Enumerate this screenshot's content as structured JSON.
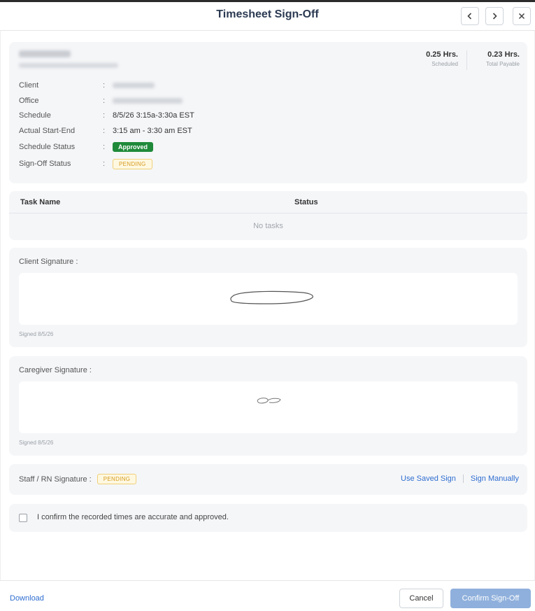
{
  "header": {
    "title": "Timesheet Sign-Off",
    "prev_icon": "chevron-left-icon",
    "next_icon": "chevron-right-icon",
    "close_icon": "close-icon"
  },
  "summary": {
    "scheduled_hours": "0.25 Hrs.",
    "scheduled_label": "Scheduled",
    "payable_hours": "0.23 Hrs.",
    "payable_label": "Total Payable"
  },
  "details": {
    "client_label": "Client",
    "office_label": "Office",
    "schedule_label": "Schedule",
    "schedule_value": "8/5/26 3:15a-3:30a EST",
    "actual_label": "Actual Start-End",
    "actual_value": "3:15 am - 3:30 am EST",
    "schedule_status_label": "Schedule Status",
    "schedule_status_value": "Approved",
    "signoff_status_label": "Sign-Off Status",
    "signoff_status_value": "PENDING",
    "colon": ":"
  },
  "tasks": {
    "col_task": "Task Name",
    "col_status": "Status",
    "empty": "No tasks"
  },
  "client_signature": {
    "label": "Client Signature :",
    "signed": "Signed 8/5/26"
  },
  "caregiver_signature": {
    "label": "Caregiver Signature :",
    "signed": "Signed 8/5/26"
  },
  "staff_signature": {
    "label": "Staff / RN Signature :",
    "status": "PENDING",
    "use_saved": "Use Saved Sign",
    "sign_manually": "Sign Manually"
  },
  "confirm": {
    "text": "I confirm the recorded times are accurate and approved."
  },
  "footer": {
    "download": "Download",
    "cancel": "Cancel",
    "confirm_signoff": "Confirm Sign-Off"
  },
  "colors": {
    "accent": "#2f6ed1",
    "approved": "#1f8a3a",
    "pending": "#d59b1f",
    "confirm_disabled": "#8fb0dc"
  }
}
